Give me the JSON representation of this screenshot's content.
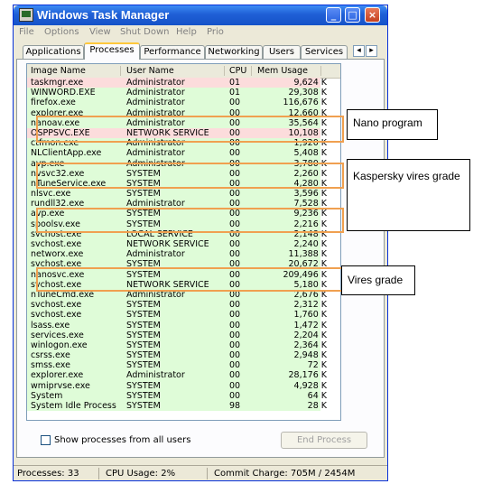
{
  "window": {
    "title": "Windows Task Manager"
  },
  "menu": [
    "File",
    "Options",
    "View",
    "Shut Down",
    "Help",
    "Prio"
  ],
  "tabs": [
    "Applications",
    "Processes",
    "Performance",
    "Networking",
    "Users",
    "Services"
  ],
  "active_tab": "Processes",
  "columns": [
    "Image Name",
    "User Name",
    "CPU",
    "Mem Usage"
  ],
  "processes": [
    {
      "image": "taskmgr.exe",
      "user": "Administrator",
      "cpu": "01",
      "mem": "9,624 K",
      "color": "red"
    },
    {
      "image": "WINWORD.EXE",
      "user": "Administrator",
      "cpu": "01",
      "mem": "29,308 K",
      "color": "green"
    },
    {
      "image": "firefox.exe",
      "user": "Administrator",
      "cpu": "00",
      "mem": "116,676 K",
      "color": "green"
    },
    {
      "image": "explorer.exe",
      "user": "Administrator",
      "cpu": "00",
      "mem": "12,660 K",
      "color": "green"
    },
    {
      "image": "nanoav.exe",
      "user": "Administrator",
      "cpu": "00",
      "mem": "35,564 K",
      "color": "green"
    },
    {
      "image": "OSPPSVC.EXE",
      "user": "NETWORK SERVICE",
      "cpu": "00",
      "mem": "10,108 K",
      "color": "red"
    },
    {
      "image": "ctfmon.exe",
      "user": "Administrator",
      "cpu": "00",
      "mem": "1,920 K",
      "color": "green"
    },
    {
      "image": "NLClientApp.exe",
      "user": "Administrator",
      "cpu": "00",
      "mem": "5,408 K",
      "color": "green"
    },
    {
      "image": "avp.exe",
      "user": "Administrator",
      "cpu": "00",
      "mem": "3,780 K",
      "color": "green"
    },
    {
      "image": "nvsvc32.exe",
      "user": "SYSTEM",
      "cpu": "00",
      "mem": "2,260 K",
      "color": "green"
    },
    {
      "image": "nTuneService.exe",
      "user": "SYSTEM",
      "cpu": "00",
      "mem": "4,280 K",
      "color": "green"
    },
    {
      "image": "nlsvc.exe",
      "user": "SYSTEM",
      "cpu": "00",
      "mem": "3,596 K",
      "color": "green"
    },
    {
      "image": "rundll32.exe",
      "user": "Administrator",
      "cpu": "00",
      "mem": "7,528 K",
      "color": "green"
    },
    {
      "image": "avp.exe",
      "user": "SYSTEM",
      "cpu": "00",
      "mem": "9,236 K",
      "color": "green"
    },
    {
      "image": "spoolsv.exe",
      "user": "SYSTEM",
      "cpu": "00",
      "mem": "2,216 K",
      "color": "green"
    },
    {
      "image": "svchost.exe",
      "user": "LOCAL SERVICE",
      "cpu": "00",
      "mem": "2,148 K",
      "color": "green"
    },
    {
      "image": "svchost.exe",
      "user": "NETWORK SERVICE",
      "cpu": "00",
      "mem": "2,240 K",
      "color": "green"
    },
    {
      "image": "networx.exe",
      "user": "Administrator",
      "cpu": "00",
      "mem": "11,388 K",
      "color": "green"
    },
    {
      "image": "svchost.exe",
      "user": "SYSTEM",
      "cpu": "00",
      "mem": "20,672 K",
      "color": "green"
    },
    {
      "image": "nanosvc.exe",
      "user": "SYSTEM",
      "cpu": "00",
      "mem": "209,496 K",
      "color": "green"
    },
    {
      "image": "svchost.exe",
      "user": "NETWORK SERVICE",
      "cpu": "00",
      "mem": "5,180 K",
      "color": "green"
    },
    {
      "image": "nTuneCmd.exe",
      "user": "Administrator",
      "cpu": "00",
      "mem": "2,676 K",
      "color": "green"
    },
    {
      "image": "svchost.exe",
      "user": "SYSTEM",
      "cpu": "00",
      "mem": "2,312 K",
      "color": "green"
    },
    {
      "image": "svchost.exe",
      "user": "SYSTEM",
      "cpu": "00",
      "mem": "1,760 K",
      "color": "green"
    },
    {
      "image": "lsass.exe",
      "user": "SYSTEM",
      "cpu": "00",
      "mem": "1,472 K",
      "color": "green"
    },
    {
      "image": "services.exe",
      "user": "SYSTEM",
      "cpu": "00",
      "mem": "2,204 K",
      "color": "green"
    },
    {
      "image": "winlogon.exe",
      "user": "SYSTEM",
      "cpu": "00",
      "mem": "2,364 K",
      "color": "green"
    },
    {
      "image": "csrss.exe",
      "user": "SYSTEM",
      "cpu": "00",
      "mem": "2,948 K",
      "color": "green"
    },
    {
      "image": "smss.exe",
      "user": "SYSTEM",
      "cpu": "00",
      "mem": "72 K",
      "color": "green"
    },
    {
      "image": "explorer.exe",
      "user": "Administrator",
      "cpu": "00",
      "mem": "28,176 K",
      "color": "green"
    },
    {
      "image": "wmiprvse.exe",
      "user": "SYSTEM",
      "cpu": "00",
      "mem": "4,928 K",
      "color": "green"
    },
    {
      "image": "System",
      "user": "SYSTEM",
      "cpu": "00",
      "mem": "64 K",
      "color": "green"
    },
    {
      "image": "System Idle Process",
      "user": "SYSTEM",
      "cpu": "98",
      "mem": "28 K",
      "color": "green"
    }
  ],
  "show_all_label": "Show processes from all users",
  "end_process_label": "End Process",
  "status": {
    "processes": "Processes: 33",
    "cpu": "CPU Usage: 2%",
    "commit": "Commit Charge: 705M / 2454M"
  },
  "annotations": {
    "nano": "Nano program",
    "kaspersky": "Kaspersky vires grade",
    "vires": "Vires grade"
  }
}
